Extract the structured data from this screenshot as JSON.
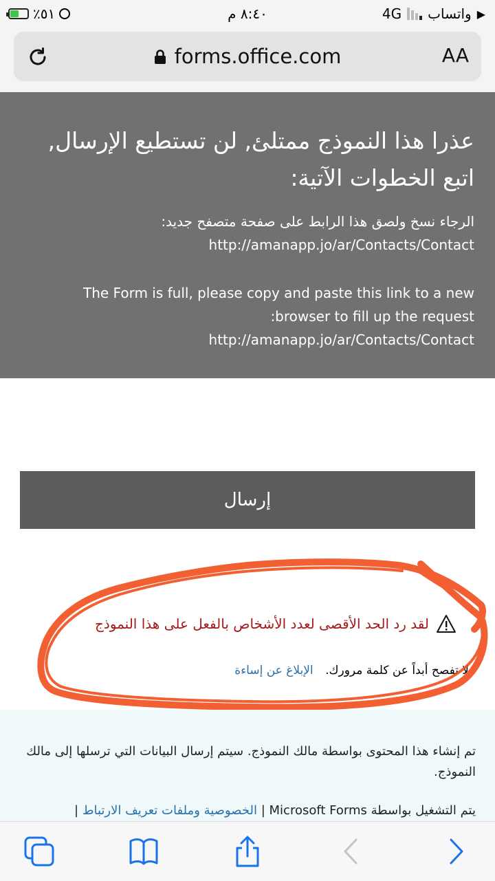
{
  "status_bar": {
    "carrier": "واتساب",
    "network": "4G",
    "time": "٨:٤٠ م",
    "battery_percent": "٪٥١",
    "battery_level": 0.51
  },
  "browser": {
    "url": "forms.office.com",
    "aa_label": "AA"
  },
  "banner": {
    "title": "عذرا هذا النموذج ممتلئ, لن تستطيع الإرسال, اتبع الخطوات الآتية:",
    "arabic_instruction": "الرجاء نسخ ولصق هذا الرابط على صفحة متصفح جديد:",
    "link_1": "http://amanapp.jo/ar/Contacts/Contact",
    "english_line_1": "The Form is full, please copy and paste this link to a new",
    "english_line_2": ":browser to fill up the request",
    "link_2": "http://amanapp.jo/ar/Contacts/Contact"
  },
  "form": {
    "send_label": "إرسال",
    "warning": "لقد رد الحد الأقصى لعدد الأشخاص بالفعل على هذا النموذج",
    "password_notice": "لا تفصح أبداً عن كلمة مرورك.",
    "report_abuse": "الإبلاغ عن إساءة"
  },
  "footer": {
    "created_by": "تم إنشاء هذا المحتوى بواسطة مالك النموذج. سيتم إرسال البيانات التي ترسلها إلى مالك النموذج.",
    "powered_by": "يتم التشغيل بواسطة Microsoft Forms |",
    "privacy_link": "الخصوصية وملفات تعريف الارتباط",
    "separator": "|"
  },
  "colors": {
    "banner_bg": "#717173",
    "send_button_bg": "#5b5c5d",
    "warning_red": "#a41a1a",
    "link_blue": "#2a6fa8",
    "scribble_orange": "#f04a16"
  }
}
